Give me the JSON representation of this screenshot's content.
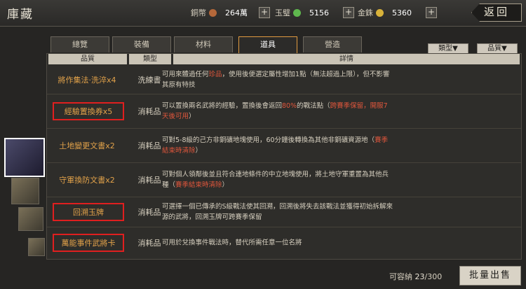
{
  "header": {
    "title": "庫藏",
    "return_label": "返回",
    "resources": [
      {
        "label": "銅幣",
        "value": "264萬",
        "color": "#b5683a"
      },
      {
        "label": "玉璧",
        "value": "5156",
        "color": "#5fb84e"
      },
      {
        "label": "金銖",
        "value": "5360",
        "color": "#d8b23a"
      }
    ],
    "plus_symbol": "+"
  },
  "tabs": [
    {
      "label": "總覽",
      "active": false
    },
    {
      "label": "裝備",
      "active": false
    },
    {
      "label": "材料",
      "active": false
    },
    {
      "label": "道具",
      "active": true
    },
    {
      "label": "營造",
      "active": false
    }
  ],
  "filters": {
    "type_label": "類型▼",
    "quality_label": "品質▼"
  },
  "table": {
    "headers": {
      "quality": "品質",
      "type": "類型",
      "detail": "詳情"
    },
    "rows": [
      {
        "name": "將作集法·洗淬x4",
        "type": "洗練書",
        "boxed": false,
        "desc": [
          "可用來體過任何",
          "珍品",
          "，使用後便選定屬性增加1點（無法超過上限），但不影響其原有特技"
        ]
      },
      {
        "name": "經驗置換券x5",
        "type": "消耗品",
        "boxed": true,
        "desc": [
          "可以置換兩名武將的經驗，置換後會返回",
          "80%",
          "的戰法點（",
          "跨賽季保留，開服7天後可用",
          "）"
        ]
      },
      {
        "name": "土地變更文書x2",
        "type": "消耗品",
        "boxed": false,
        "desc": [
          "可對5-8級的己方非銅礦地塊使用，60分鐘後轉換為其他非銅礦資源地（",
          "賽季結束時清除",
          "）"
        ]
      },
      {
        "name": "守軍換防文書x2",
        "type": "消耗品",
        "boxed": false,
        "desc": [
          "可對個人領鄰後並且符合連地條件的中立地塊使用，將土地守軍重置為其他兵種（",
          "賽季結束時清除",
          "）"
        ]
      },
      {
        "name": "回溯玉牌",
        "type": "消耗品",
        "boxed": true,
        "desc": [
          "可選擇一個已傳承的S級戰法使其回溯，回溯後將失去該戰法並獲得初始拆解來源的武將，回溯玉牌可跨賽季保留",
          "",
          "",
          "",
          ""
        ]
      },
      {
        "name": "萬能事件武將卡",
        "type": "消耗品",
        "boxed": true,
        "desc": [
          "可用於兌換事件戰法時，替代所需任意一位名將",
          "",
          "",
          "",
          ""
        ]
      }
    ]
  },
  "footer": {
    "capacity_label": "可容納",
    "capacity_used": "23",
    "capacity_total": "/300",
    "sell_label": "批量出售"
  }
}
